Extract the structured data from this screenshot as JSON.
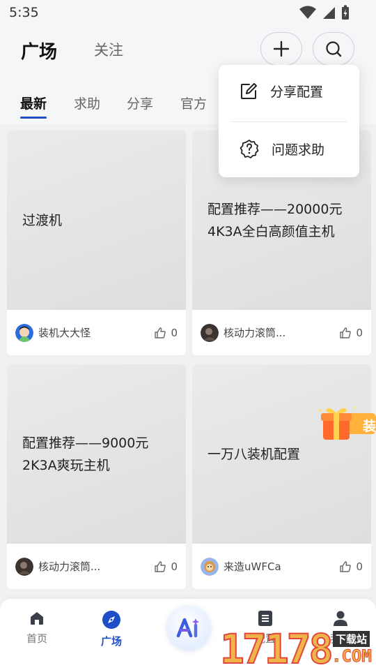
{
  "status": {
    "time": "5:35"
  },
  "header": {
    "title": "广场",
    "follow": "关注"
  },
  "tabs": [
    "最新",
    "求助",
    "分享",
    "官方"
  ],
  "popup": {
    "share_config": "分享配置",
    "ask_help": "问题求助"
  },
  "cards": [
    {
      "title": "过渡机",
      "author": "装机大大怪",
      "likes": "0"
    },
    {
      "title": "配置推荐——20000元4K3A全白高颜值主机",
      "author": "核动力滚筒...",
      "likes": "0"
    },
    {
      "title": "配置推荐——9000元2K3A爽玩主机",
      "author": "核动力滚筒...",
      "likes": "0"
    },
    {
      "title": "一万八装机配置",
      "author": "来造uWFCa",
      "likes": "0"
    }
  ],
  "gift_text": "装",
  "nav": {
    "home": "首页",
    "square": "广场",
    "config": "配置",
    "mine": "我的"
  },
  "watermark": {
    "brand": "17178",
    "sub": "下载站",
    "domain": ".COM"
  },
  "colors": {
    "accent": "#1e4fc8"
  }
}
